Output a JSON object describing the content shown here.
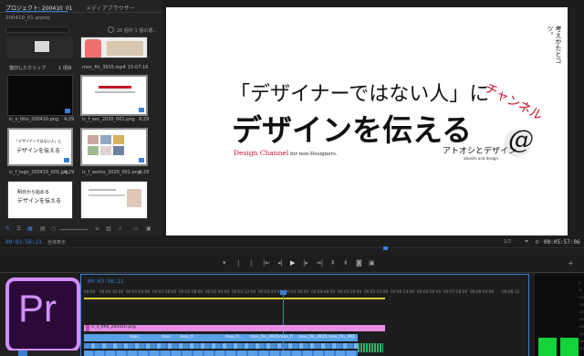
{
  "project": {
    "tab_label": "プロジェクト: 200410_01",
    "tab2_label": "メディアブラウザー",
    "file_name": "200410_01.prproj",
    "item_count": "26 個中 1 個の選...",
    "items": [
      {
        "name": "復旧したクリップ",
        "meta": "1 項目"
      },
      {
        "name": "mov_fin_3915.mp4",
        "meta": "15:07:10"
      },
      {
        "name": "ic_s_title_200410.png",
        "meta": "4;29"
      },
      {
        "name": "ic_f_sec_2020_001.png",
        "meta": "4;29"
      },
      {
        "name": "ic_f_logo_200410_001.jpg",
        "meta": "4;29"
      },
      {
        "name": "ic_f_works_2020_001.png",
        "meta": "4;29"
      }
    ],
    "thumb_text": {
      "sub_pink": "「デザイナーではない人」に",
      "sub_main": "デザインを伝える",
      "tag": "明日から始める"
    }
  },
  "monitor": {
    "title_line1": "「デザイナーではない人」に",
    "title_line2": "デザインを伝える",
    "subtitle_red": "Design Channel",
    "subtitle_rest": " for non-Designers.",
    "vertical_black": "考えかたとコツ。",
    "katakana": "チャンネル",
    "logo_text": "アトオシとデザイン",
    "logo_small": "atooshi and design",
    "timecode_left": "00:03:56:21",
    "fit_label": "全体表示",
    "ratio": "1/2",
    "timecode_right": "00:05:57:06"
  },
  "timeline": {
    "timecode": "00:03:56:21",
    "ruler": [
      "00:00",
      "00:00:32:00",
      "00:01:04:00",
      "00:01:36:00",
      "00:02:08:00",
      "00:02:40:00",
      "00:03:12:00",
      "00:03:44:00",
      "00:04:16:00",
      "00:04:48:00",
      "00:05:20:00",
      "00:05:52:00",
      "00:06:24:00",
      "00:06:56:00",
      "00:07:28:00",
      "00:08:00:00",
      "00:08:32"
    ],
    "clip_title": "ic_s_title_200410.png",
    "clip_names": [
      "mov_",
      "mov",
      "mov_fi",
      "mov_fi",
      "mov_fin_3915",
      "mov_fin_3915",
      "mov_fi",
      "mov_fin_391"
    ]
  },
  "app_logo": "Pr",
  "meter_ticks": [
    "0",
    "-6",
    "-12",
    "-18",
    "-24",
    "-30",
    "-36",
    "-42",
    "-48",
    "-54"
  ],
  "colors": {
    "accent_blue": "#3a7fd5",
    "clip_pink": "#e58ee3",
    "clip_blue": "#5aa0e6",
    "logo_bg": "#2b0a3a",
    "logo_accent": "#d28ffc",
    "meter_green": "#15d13a",
    "red": "#c8132a"
  }
}
